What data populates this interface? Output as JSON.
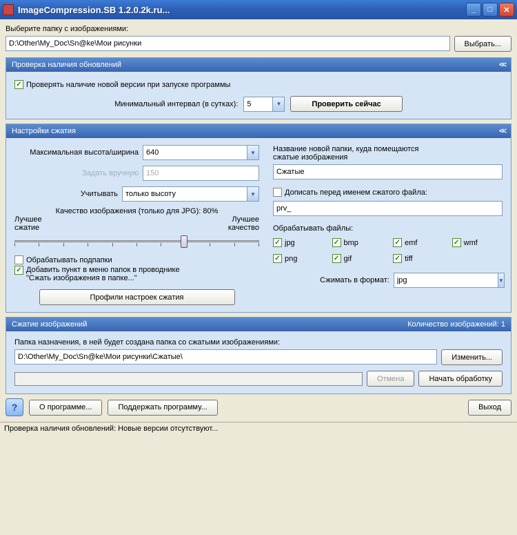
{
  "window": {
    "title": "ImageCompression.SB 1.2.0.2k.ru..."
  },
  "folder_select": {
    "label": "Выберите папку с изображениями:",
    "path": "D:\\Other\\My_Doc\\Sn@ke\\Мои рисунки",
    "browse": "Выбрать..."
  },
  "updates": {
    "title": "Проверка наличия обновлений",
    "collapse": "<<",
    "check_on_start": "Проверять наличие новой версии при запуске программы",
    "interval_label": "Минимальный интервал (в сутках):",
    "interval_value": "5",
    "check_now": "Проверить сейчас"
  },
  "settings": {
    "title": "Настройки сжатия",
    "collapse": "<<",
    "max_dim_label": "Максимальная высота/ширина",
    "max_dim_value": "640",
    "manual_label": "Задать вручную",
    "manual_value": "150",
    "consider_label": "Учитывать",
    "consider_value": "только высоту",
    "quality_label": "Качество изображения (только для JPG): 80%",
    "slider_left_a": "Лучшее",
    "slider_left_b": "сжатие",
    "slider_right_a": "Лучшее",
    "slider_right_b": "качество",
    "process_subfolders": "Обрабатывать подпапки",
    "explorer_menu_a": "Добавить пункт в меню папок в проводнике",
    "explorer_menu_b": "\"Сжать изображения в папке...\"",
    "profiles_btn": "Профили настроек сжатия",
    "newfolder_label_a": "Название новой папки, куда помещаются",
    "newfolder_label_b": "сжатые изображения",
    "newfolder_value": "Сжатые",
    "prefix_label": "Дописать перед именем сжатого файла:",
    "prefix_value": "prv_",
    "filetypes_label": "Обрабатывать файлы:",
    "ft_jpg": "jpg",
    "ft_bmp": "bmp",
    "ft_emf": "emf",
    "ft_wmf": "wmf",
    "ft_png": "png",
    "ft_gif": "gif",
    "ft_tiff": "tiff",
    "outfmt_label": "Сжимать в формат:",
    "outfmt_value": "jpg"
  },
  "compress": {
    "title": "Сжатие изображений",
    "count": "Количество изображений: 1",
    "dest_label": "Папка назначения, в ней будет создана папка со сжатыми изображениями:",
    "dest_value": "D:\\Other\\My_Doc\\Sn@ke\\Мои рисунки\\Сжатые\\",
    "change": "Изменить...",
    "cancel": "Отмена",
    "start": "Начать обработку"
  },
  "bottom": {
    "about": "О программе...",
    "support": "Поддержать программу...",
    "exit": "Выход"
  },
  "status": "Проверка наличия обновлений: Новые версии отсутствуют..."
}
